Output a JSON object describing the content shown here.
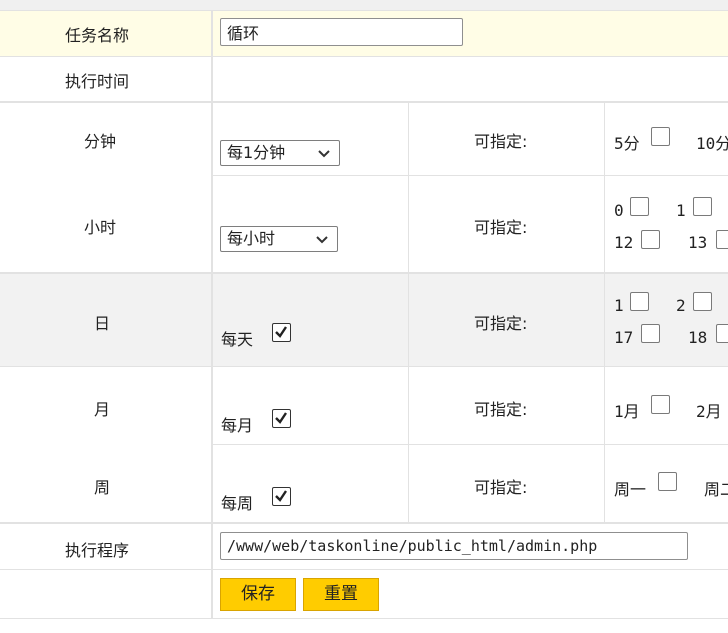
{
  "form": {
    "task_name_label": "任务名称",
    "task_name_value": "循环",
    "exec_time_label": "执行时间",
    "specifiable_label": "可指定:",
    "minute": {
      "label": "分钟",
      "select_value": "每1分钟",
      "options": [
        {
          "label": "5分",
          "checked": false
        },
        {
          "label": "10分",
          "checked": false
        }
      ]
    },
    "hour": {
      "label": "小时",
      "select_value": "每小时",
      "options_row1": [
        {
          "label": "0",
          "checked": false
        },
        {
          "label": "1",
          "checked": false
        }
      ],
      "options_row2": [
        {
          "label": "12",
          "checked": false
        },
        {
          "label": "13",
          "checked": false
        }
      ]
    },
    "day": {
      "label": "日",
      "every_label": "每天",
      "every_checked": true,
      "options_row1": [
        {
          "label": "1",
          "checked": false
        },
        {
          "label": "2",
          "checked": false
        }
      ],
      "options_row2": [
        {
          "label": "17",
          "checked": false
        },
        {
          "label": "18",
          "checked": false
        }
      ]
    },
    "month": {
      "label": "月",
      "every_label": "每月",
      "every_checked": true,
      "options": [
        {
          "label": "1月",
          "checked": false
        },
        {
          "label": "2月",
          "checked": false
        }
      ]
    },
    "week": {
      "label": "周",
      "every_label": "每周",
      "every_checked": true,
      "options": [
        {
          "label": "周一",
          "checked": false
        },
        {
          "label": "周二",
          "checked": false
        }
      ]
    },
    "program_label": "执行程序",
    "program_value": "/www/web/taskonline/public_html/admin.php",
    "save_label": "保存",
    "reset_label": "重置"
  },
  "colors": {
    "highlight_row": "#fffde6",
    "day_row": "#f2f2f2",
    "button": "#ffcc00"
  }
}
